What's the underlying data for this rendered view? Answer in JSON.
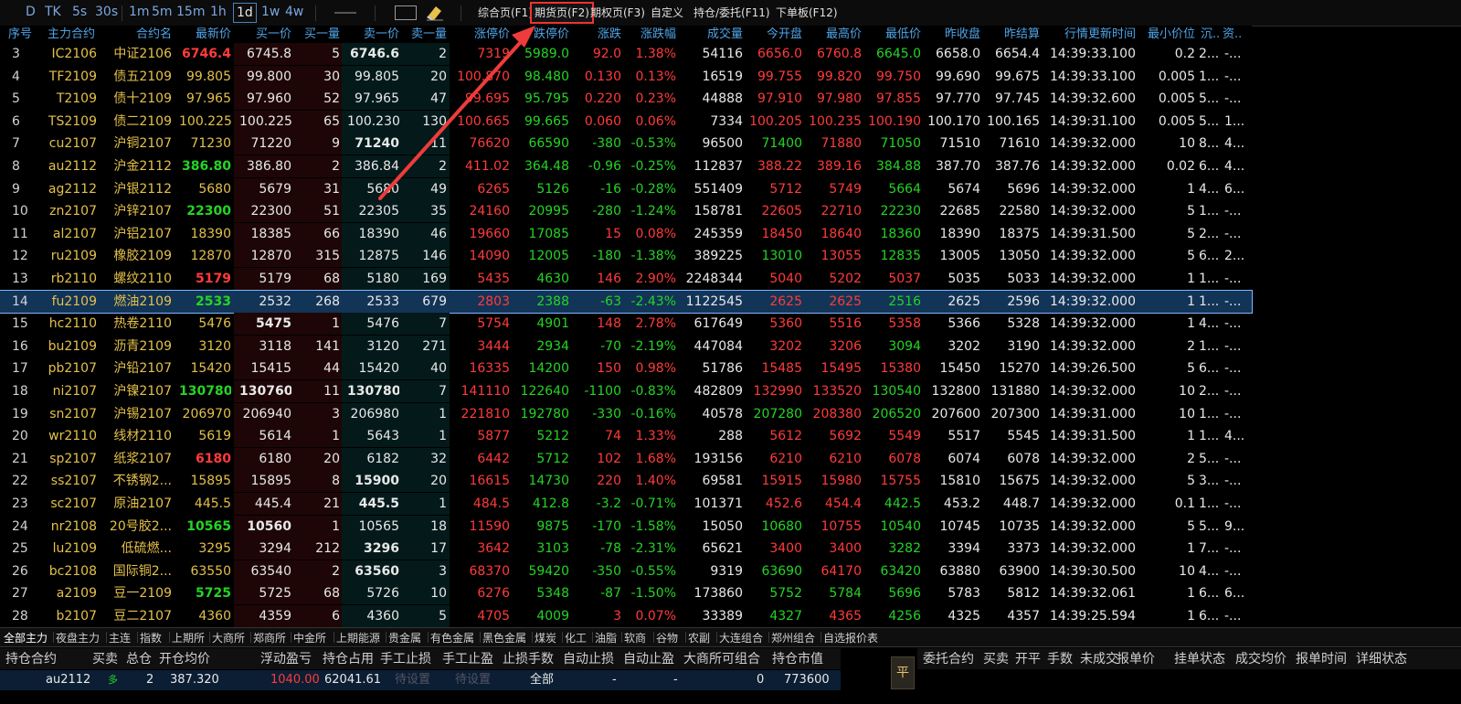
{
  "toolbar": {
    "periods": [
      "D",
      "TK",
      "5s",
      "30s",
      "1m",
      "5m",
      "15m",
      "1h",
      "1d",
      "1w",
      "4w"
    ],
    "selected_period": "1d",
    "pages": [
      "综合页(F1)",
      "期货页(F2)",
      "期权页(F3)",
      "自定义",
      "持仓/委托(F11)",
      "下单板(F12)"
    ],
    "highlighted_page": "期货页(F2)"
  },
  "columns": [
    "序号",
    "主力合约",
    "合约名",
    "最新价",
    "买一价",
    "买一量",
    "卖一价",
    "卖一量",
    "涨停价",
    "跌停价",
    "涨跌",
    "涨跌幅",
    "成交量",
    "今开盘",
    "最高价",
    "最低价",
    "昨收盘",
    "昨结算",
    "行情更新时间",
    "最小价位",
    "沉...",
    "资..."
  ],
  "rows": [
    {
      "idx": "3",
      "code": "IC2106",
      "name": "中证2106",
      "last": "6746.4",
      "bid": "6745.8",
      "bidv": "5",
      "ask": "6746.6",
      "askv": "2",
      "up": "7319",
      "down": "5989.0",
      "chg": "92.0",
      "pct": "1.38%",
      "vol": "54116",
      "open": "6656.0",
      "high": "6760.8",
      "low": "6645.0",
      "pclose": "6658.0",
      "psettle": "6654.4",
      "time": "14:39:33.100",
      "tick": "0.2",
      "c1": "2...",
      "c2": "-..."
    },
    {
      "idx": "4",
      "code": "TF2109",
      "name": "债五2109",
      "last": "99.805",
      "bid": "99.800",
      "bidv": "30",
      "ask": "99.805",
      "askv": "20",
      "up": "100.870",
      "down": "98.480",
      "chg": "0.130",
      "pct": "0.13%",
      "vol": "16519",
      "open": "99.755",
      "high": "99.820",
      "low": "99.750",
      "pclose": "99.690",
      "psettle": "99.675",
      "time": "14:39:33.100",
      "tick": "0.005",
      "c1": "1...",
      "c2": "-..."
    },
    {
      "idx": "5",
      "code": "T2109",
      "name": "债十2109",
      "last": "97.965",
      "bid": "97.960",
      "bidv": "52",
      "ask": "97.965",
      "askv": "47",
      "up": "99.695",
      "down": "95.795",
      "chg": "0.220",
      "pct": "0.23%",
      "vol": "44888",
      "open": "97.910",
      "high": "97.980",
      "low": "97.855",
      "pclose": "97.770",
      "psettle": "97.745",
      "time": "14:39:32.600",
      "tick": "0.005",
      "c1": "5...",
      "c2": "-..."
    },
    {
      "idx": "6",
      "code": "TS2109",
      "name": "债二2109",
      "last": "100.225",
      "bid": "100.225",
      "bidv": "65",
      "ask": "100.230",
      "askv": "130",
      "up": "100.665",
      "down": "99.665",
      "chg": "0.060",
      "pct": "0.06%",
      "vol": "7334",
      "open": "100.205",
      "high": "100.235",
      "low": "100.190",
      "pclose": "100.170",
      "psettle": "100.165",
      "time": "14:39:31.100",
      "tick": "0.005",
      "c1": "5...",
      "c2": "1..."
    },
    {
      "idx": "7",
      "code": "cu2107",
      "name": "沪铜2107",
      "last": "71230",
      "bid": "71220",
      "bidv": "9",
      "ask": "71240",
      "askv": "11",
      "up": "76620",
      "down": "66590",
      "chg": "-380",
      "pct": "-0.53%",
      "vol": "96500",
      "open": "71400",
      "high": "71880",
      "low": "71050",
      "pclose": "71510",
      "psettle": "71610",
      "time": "14:39:32.000",
      "tick": "10",
      "c1": "8...",
      "c2": "4..."
    },
    {
      "idx": "8",
      "code": "au2112",
      "name": "沪金2112",
      "last": "386.80",
      "bid": "386.80",
      "bidv": "2",
      "ask": "386.84",
      "askv": "2",
      "up": "411.02",
      "down": "364.48",
      "chg": "-0.96",
      "pct": "-0.25%",
      "vol": "112837",
      "open": "388.22",
      "high": "389.16",
      "low": "384.88",
      "pclose": "387.70",
      "psettle": "387.76",
      "time": "14:39:32.000",
      "tick": "0.02",
      "c1": "6...",
      "c2": "4..."
    },
    {
      "idx": "9",
      "code": "ag2112",
      "name": "沪银2112",
      "last": "5680",
      "bid": "5679",
      "bidv": "31",
      "ask": "5680",
      "askv": "49",
      "up": "6265",
      "down": "5126",
      "chg": "-16",
      "pct": "-0.28%",
      "vol": "551409",
      "open": "5712",
      "high": "5749",
      "low": "5664",
      "pclose": "5674",
      "psettle": "5696",
      "time": "14:39:32.000",
      "tick": "1",
      "c1": "4...",
      "c2": "6..."
    },
    {
      "idx": "10",
      "code": "zn2107",
      "name": "沪锌2107",
      "last": "22300",
      "bid": "22300",
      "bidv": "51",
      "ask": "22305",
      "askv": "35",
      "up": "24160",
      "down": "20995",
      "chg": "-280",
      "pct": "-1.24%",
      "vol": "158781",
      "open": "22605",
      "high": "22710",
      "low": "22230",
      "pclose": "22685",
      "psettle": "22580",
      "time": "14:39:32.000",
      "tick": "5",
      "c1": "1...",
      "c2": "-..."
    },
    {
      "idx": "11",
      "code": "al2107",
      "name": "沪铝2107",
      "last": "18390",
      "bid": "18385",
      "bidv": "66",
      "ask": "18390",
      "askv": "46",
      "up": "19660",
      "down": "17085",
      "chg": "15",
      "pct": "0.08%",
      "vol": "245359",
      "open": "18450",
      "high": "18640",
      "low": "18360",
      "pclose": "18390",
      "psettle": "18375",
      "time": "14:39:31.500",
      "tick": "5",
      "c1": "2...",
      "c2": "-..."
    },
    {
      "idx": "12",
      "code": "ru2109",
      "name": "橡胶2109",
      "last": "12870",
      "bid": "12870",
      "bidv": "315",
      "ask": "12875",
      "askv": "146",
      "up": "14090",
      "down": "12005",
      "chg": "-180",
      "pct": "-1.38%",
      "vol": "389225",
      "open": "13010",
      "high": "13055",
      "low": "12835",
      "pclose": "13005",
      "psettle": "13050",
      "time": "14:39:32.000",
      "tick": "5",
      "c1": "6...",
      "c2": "2..."
    },
    {
      "idx": "13",
      "code": "rb2110",
      "name": "螺纹2110",
      "last": "5179",
      "bid": "5179",
      "bidv": "68",
      "ask": "5180",
      "askv": "169",
      "up": "5435",
      "down": "4630",
      "chg": "146",
      "pct": "2.90%",
      "vol": "2248344",
      "open": "5040",
      "high": "5202",
      "low": "5037",
      "pclose": "5035",
      "psettle": "5033",
      "time": "14:39:32.000",
      "tick": "1",
      "c1": "1...",
      "c2": "-..."
    },
    {
      "idx": "14",
      "code": "fu2109",
      "name": "燃油2109",
      "last": "2533",
      "bid": "2532",
      "bidv": "268",
      "ask": "2533",
      "askv": "679",
      "up": "2803",
      "down": "2388",
      "chg": "-63",
      "pct": "-2.43%",
      "vol": "1122545",
      "open": "2625",
      "high": "2625",
      "low": "2516",
      "pclose": "2625",
      "psettle": "2596",
      "time": "14:39:32.000",
      "tick": "1",
      "c1": "1...",
      "c2": "-..."
    },
    {
      "idx": "15",
      "code": "hc2110",
      "name": "热卷2110",
      "last": "5476",
      "bid": "5475",
      "bidv": "1",
      "ask": "5476",
      "askv": "7",
      "up": "5754",
      "down": "4901",
      "chg": "148",
      "pct": "2.78%",
      "vol": "617649",
      "open": "5360",
      "high": "5516",
      "low": "5358",
      "pclose": "5366",
      "psettle": "5328",
      "time": "14:39:32.000",
      "tick": "1",
      "c1": "4...",
      "c2": "-..."
    },
    {
      "idx": "16",
      "code": "bu2109",
      "name": "沥青2109",
      "last": "3120",
      "bid": "3118",
      "bidv": "141",
      "ask": "3120",
      "askv": "271",
      "up": "3444",
      "down": "2934",
      "chg": "-70",
      "pct": "-2.19%",
      "vol": "447084",
      "open": "3202",
      "high": "3206",
      "low": "3094",
      "pclose": "3202",
      "psettle": "3190",
      "time": "14:39:32.000",
      "tick": "2",
      "c1": "1...",
      "c2": "-..."
    },
    {
      "idx": "17",
      "code": "pb2107",
      "name": "沪铅2107",
      "last": "15420",
      "bid": "15415",
      "bidv": "44",
      "ask": "15420",
      "askv": "40",
      "up": "16335",
      "down": "14200",
      "chg": "150",
      "pct": "0.98%",
      "vol": "51786",
      "open": "15485",
      "high": "15495",
      "low": "15380",
      "pclose": "15450",
      "psettle": "15270",
      "time": "14:39:26.500",
      "tick": "5",
      "c1": "6...",
      "c2": "-..."
    },
    {
      "idx": "18",
      "code": "ni2107",
      "name": "沪镍2107",
      "last": "130780",
      "bid": "130760",
      "bidv": "11",
      "ask": "130780",
      "askv": "7",
      "up": "141110",
      "down": "122640",
      "chg": "-1100",
      "pct": "-0.83%",
      "vol": "482809",
      "open": "132990",
      "high": "133520",
      "low": "130540",
      "pclose": "132800",
      "psettle": "131880",
      "time": "14:39:32.000",
      "tick": "10",
      "c1": "2...",
      "c2": "-..."
    },
    {
      "idx": "19",
      "code": "sn2107",
      "name": "沪锡2107",
      "last": "206970",
      "bid": "206940",
      "bidv": "3",
      "ask": "206980",
      "askv": "1",
      "up": "221810",
      "down": "192780",
      "chg": "-330",
      "pct": "-0.16%",
      "vol": "40578",
      "open": "207280",
      "high": "208380",
      "low": "206520",
      "pclose": "207600",
      "psettle": "207300",
      "time": "14:39:31.000",
      "tick": "10",
      "c1": "1...",
      "c2": "-..."
    },
    {
      "idx": "20",
      "code": "wr2110",
      "name": "线材2110",
      "last": "5619",
      "bid": "5614",
      "bidv": "1",
      "ask": "5643",
      "askv": "1",
      "up": "5877",
      "down": "5212",
      "chg": "74",
      "pct": "1.33%",
      "vol": "288",
      "open": "5612",
      "high": "5692",
      "low": "5549",
      "pclose": "5517",
      "psettle": "5545",
      "time": "14:39:31.500",
      "tick": "1",
      "c1": "1...",
      "c2": "4..."
    },
    {
      "idx": "21",
      "code": "sp2107",
      "name": "纸浆2107",
      "last": "6180",
      "bid": "6180",
      "bidv": "20",
      "ask": "6182",
      "askv": "32",
      "up": "6442",
      "down": "5712",
      "chg": "102",
      "pct": "1.68%",
      "vol": "193156",
      "open": "6210",
      "high": "6210",
      "low": "6078",
      "pclose": "6074",
      "psettle": "6078",
      "time": "14:39:32.000",
      "tick": "2",
      "c1": "5...",
      "c2": "-..."
    },
    {
      "idx": "22",
      "code": "ss2107",
      "name": "不锈钢2...",
      "last": "15895",
      "bid": "15895",
      "bidv": "8",
      "ask": "15900",
      "askv": "20",
      "up": "16615",
      "down": "14730",
      "chg": "220",
      "pct": "1.40%",
      "vol": "69581",
      "open": "15915",
      "high": "15980",
      "low": "15755",
      "pclose": "15810",
      "psettle": "15675",
      "time": "14:39:32.000",
      "tick": "5",
      "c1": "3...",
      "c2": "-..."
    },
    {
      "idx": "23",
      "code": "sc2107",
      "name": "原油2107",
      "last": "445.5",
      "bid": "445.4",
      "bidv": "21",
      "ask": "445.5",
      "askv": "1",
      "up": "484.5",
      "down": "412.8",
      "chg": "-3.2",
      "pct": "-0.71%",
      "vol": "101371",
      "open": "452.6",
      "high": "454.4",
      "low": "442.5",
      "pclose": "453.2",
      "psettle": "448.7",
      "time": "14:39:32.000",
      "tick": "0.1",
      "c1": "1...",
      "c2": "-..."
    },
    {
      "idx": "24",
      "code": "nr2108",
      "name": "20号胶2...",
      "last": "10565",
      "bid": "10560",
      "bidv": "1",
      "ask": "10565",
      "askv": "18",
      "up": "11590",
      "down": "9875",
      "chg": "-170",
      "pct": "-1.58%",
      "vol": "15050",
      "open": "10680",
      "high": "10755",
      "low": "10540",
      "pclose": "10745",
      "psettle": "10735",
      "time": "14:39:32.000",
      "tick": "5",
      "c1": "5...",
      "c2": "9..."
    },
    {
      "idx": "25",
      "code": "lu2109",
      "name": "低硫燃...",
      "last": "3295",
      "bid": "3294",
      "bidv": "212",
      "ask": "3296",
      "askv": "17",
      "up": "3642",
      "down": "3103",
      "chg": "-78",
      "pct": "-2.31%",
      "vol": "65621",
      "open": "3400",
      "high": "3400",
      "low": "3282",
      "pclose": "3394",
      "psettle": "3373",
      "time": "14:39:32.000",
      "tick": "1",
      "c1": "7...",
      "c2": "-..."
    },
    {
      "idx": "26",
      "code": "bc2108",
      "name": "国际铜2...",
      "last": "63550",
      "bid": "63540",
      "bidv": "2",
      "ask": "63560",
      "askv": "3",
      "up": "68370",
      "down": "59420",
      "chg": "-350",
      "pct": "-0.55%",
      "vol": "9319",
      "open": "63690",
      "high": "64170",
      "low": "63420",
      "pclose": "63880",
      "psettle": "63900",
      "time": "14:39:30.500",
      "tick": "10",
      "c1": "4...",
      "c2": "-..."
    },
    {
      "idx": "27",
      "code": "a2109",
      "name": "豆一2109",
      "last": "5725",
      "bid": "5725",
      "bidv": "68",
      "ask": "5726",
      "askv": "10",
      "up": "6276",
      "down": "5348",
      "chg": "-87",
      "pct": "-1.50%",
      "vol": "173860",
      "open": "5752",
      "high": "5784",
      "low": "5696",
      "pclose": "5783",
      "psettle": "5812",
      "time": "14:39:32.061",
      "tick": "1",
      "c1": "6...",
      "c2": "6..."
    },
    {
      "idx": "28",
      "code": "b2107",
      "name": "豆二2107",
      "last": "4360",
      "bid": "4359",
      "bidv": "6",
      "ask": "4360",
      "askv": "5",
      "up": "4705",
      "down": "4009",
      "chg": "3",
      "pct": "0.07%",
      "vol": "33389",
      "open": "4327",
      "high": "4365",
      "low": "4256",
      "pclose": "4325",
      "psettle": "4357",
      "time": "14:39:25.594",
      "tick": "1",
      "c1": "6...",
      "c2": "-..."
    }
  ],
  "tabs": [
    "全部主力",
    "夜盘主力",
    "主连",
    "指数",
    "上期所",
    "大商所",
    "郑商所",
    "中金所",
    "上期能源",
    "贵金属",
    "有色金属",
    "黑色金属",
    "煤炭",
    "化工",
    "油脂",
    "软商",
    "谷物",
    "农副",
    "大连组合",
    "郑州组合",
    "自选报价表"
  ],
  "positions": {
    "headers": [
      "持仓合约",
      "买卖",
      "总仓",
      "开仓均价",
      "浮动盈亏",
      "持仓占用",
      "手工止损",
      "手工止盈",
      "止损手数",
      "自动止损",
      "自动止盈",
      "大商所可组合",
      "持仓市值"
    ],
    "row": {
      "contract": "au2112",
      "side": "多",
      "total": "2",
      "avg": "387.320",
      "pnl": "1040.00",
      "margin": "62041.61",
      "stop": "待设置",
      "take": "待设置",
      "qty": "全部",
      "auto_stop": "-",
      "auto_take": "-",
      "dce": "0",
      "value": "773600"
    }
  },
  "close_button": "平",
  "orders": {
    "headers": [
      "委托合约",
      "买卖",
      "开平",
      "手数",
      "未成交",
      "报单价",
      "挂单状态",
      "成交均价",
      "报单时间",
      "详细状态"
    ]
  }
}
